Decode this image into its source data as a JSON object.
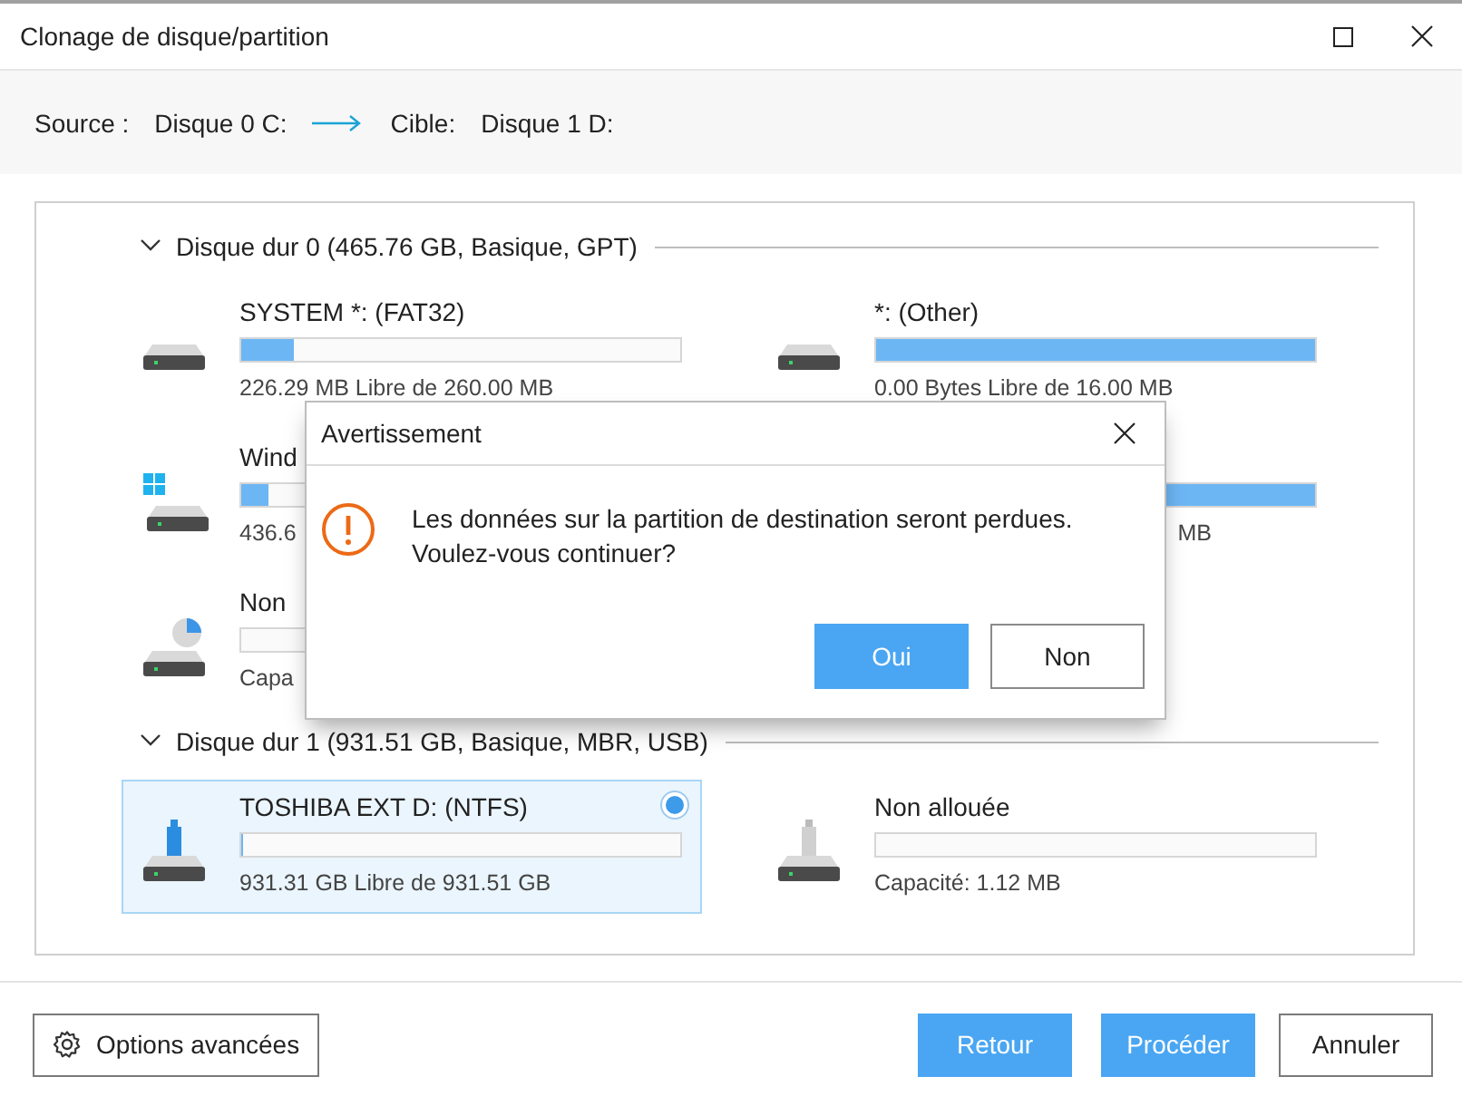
{
  "window": {
    "title": "Clonage de disque/partition"
  },
  "header": {
    "source_label": "Source :",
    "source_value": "Disque 0 C:",
    "target_label": "Cible:",
    "target_value": "Disque 1 D:"
  },
  "disks": [
    {
      "title": "Disque dur 0 (465.76 GB, Basique, GPT)",
      "expanded": true,
      "partitions": [
        {
          "name": "SYSTEM *: (FAT32)",
          "kind": "hdd",
          "level": 0.12,
          "info": "226.29 MB Libre de 260.00 MB",
          "selected": false,
          "obscured": false
        },
        {
          "name": "*: (Other)",
          "kind": "hdd",
          "level": 1,
          "info": "0.00 Bytes Libre de 16.00 MB",
          "selected": false,
          "obscured": false
        },
        {
          "name": "Wind",
          "kind": "windows",
          "level": 0.06,
          "info": "436.6",
          "selected": false,
          "obscured": false
        },
        {
          "level": 1,
          "info": "MB",
          "selected": false,
          "obscured": true
        },
        {
          "name": "Non",
          "kind": "pie",
          "info": "Capa",
          "selected": false,
          "obscured": false
        }
      ]
    },
    {
      "title": "Disque dur 1 (931.51 GB, Basique, MBR, USB)",
      "expanded": true,
      "partitions": [
        {
          "name": "TOSHIBA EXT D: (NTFS)",
          "kind": "usb",
          "level": 0.005,
          "info": "931.31 GB Libre de 931.51 GB",
          "selected": true,
          "obscured": false
        },
        {
          "name": "Non allouée",
          "kind": "usb-empty",
          "info": "Capacité: 1.12 MB",
          "selected": false,
          "obscured": false
        }
      ]
    }
  ],
  "dialog": {
    "title": "Avertissement",
    "message": [
      "Les données sur la partition de destination seront perdues.",
      "Voulez-vous continuer?"
    ],
    "buttons": [
      {
        "label": "Oui",
        "primary": true
      },
      {
        "label": "Non",
        "primary": false
      }
    ]
  },
  "footer": {
    "options_button": "Options avancées",
    "buttons": [
      {
        "label": "Retour",
        "primary": true
      },
      {
        "label": "Procéder",
        "primary": true
      },
      {
        "label": "Annuler",
        "primary": false
      }
    ]
  }
}
